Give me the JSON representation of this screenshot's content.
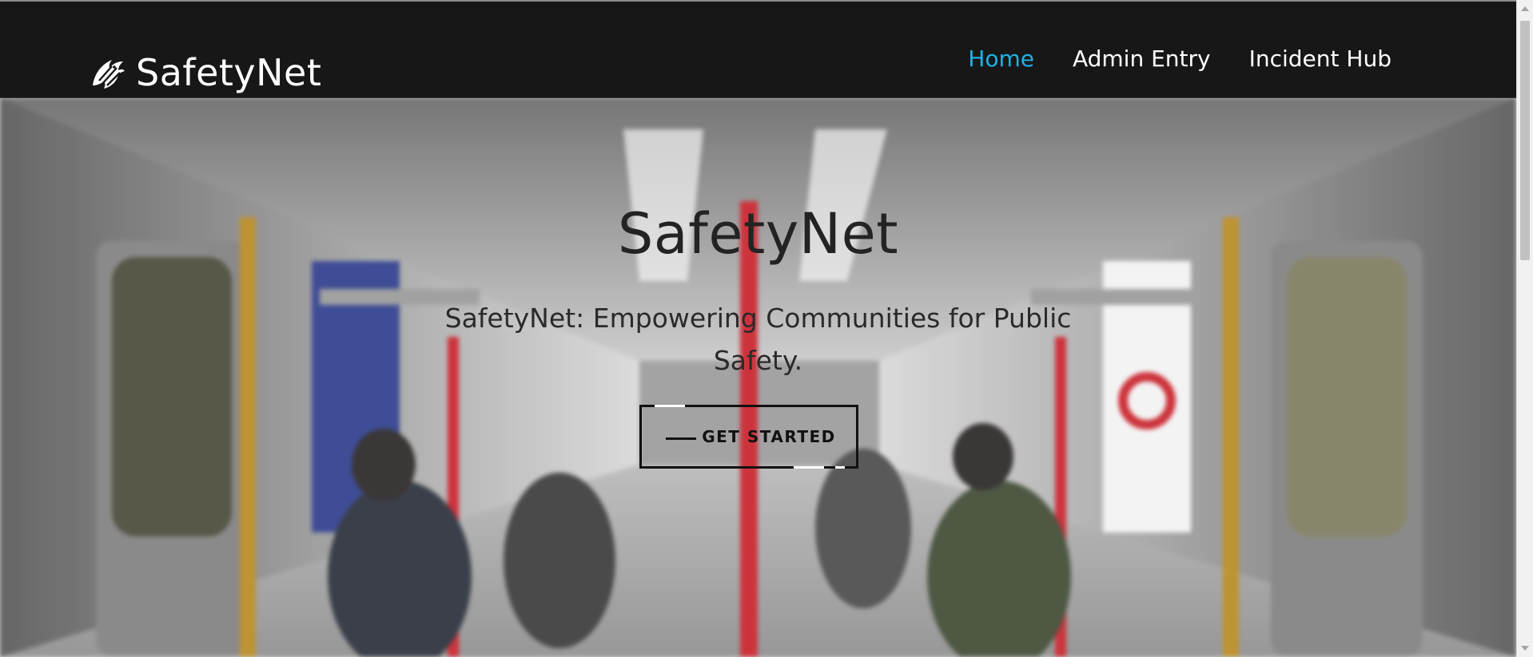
{
  "brand": {
    "name": "SafetyNet",
    "logo_icon": "eagle-head-icon"
  },
  "nav": {
    "items": [
      {
        "label": "Home",
        "active": true
      },
      {
        "label": "Admin Entry",
        "active": false
      },
      {
        "label": "Incident Hub",
        "active": false
      }
    ]
  },
  "hero": {
    "title": "SafetyNet",
    "subtitle": "SafetyNet: Empowering Communities for Public Safety.",
    "cta_label": "GET STARTED",
    "background": "subway-car-interior-photo"
  },
  "colors": {
    "navbar_bg": "#171717",
    "nav_active": "#1fb1e6",
    "nav_text": "#ffffff",
    "hero_text": "#232323"
  }
}
